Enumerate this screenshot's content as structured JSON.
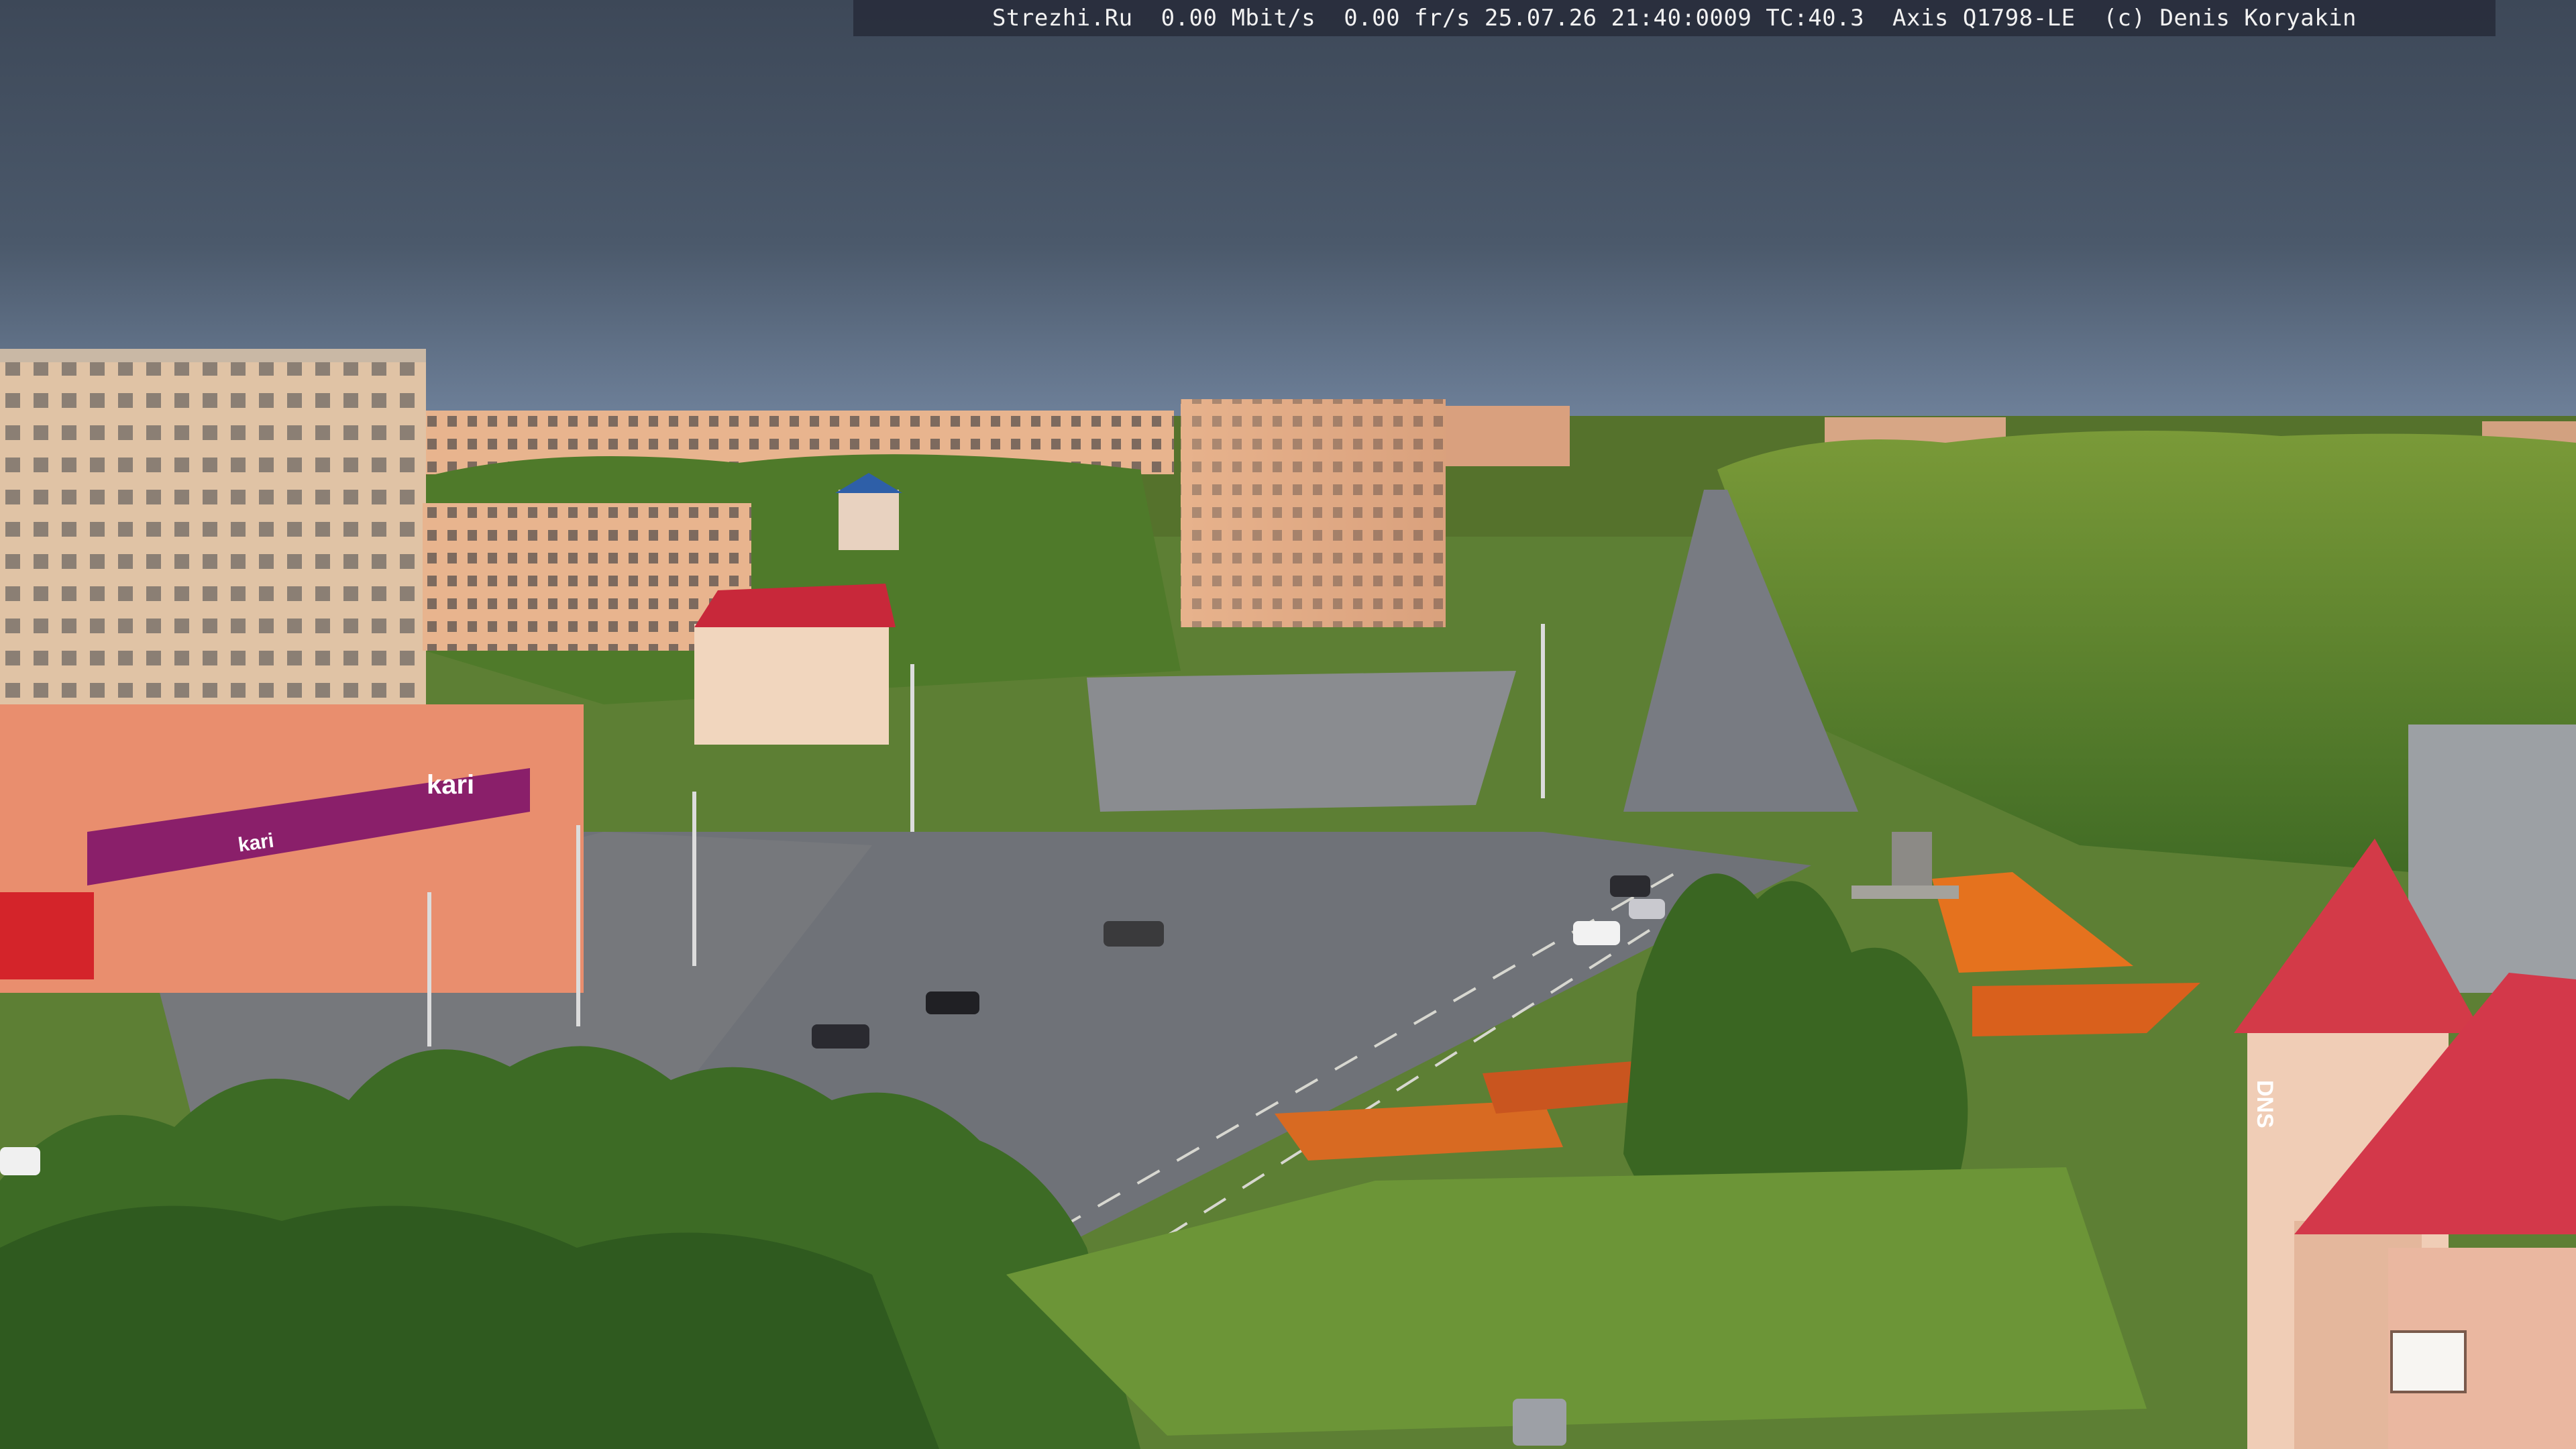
{
  "overlay": {
    "text": "Strezhi.Ru  0.00 Mbit/s  0.00 fr/s 25.07.26 21:40:0009 TC:40.3  Axis Q1798-LE  (c) Denis Koryakin"
  },
  "signs": {
    "kari_main": "kari",
    "kari_small": "kari",
    "tower_letters": "DNS"
  },
  "colors": {
    "sky_top": "#3e4a5c",
    "sky_horizon": "#6e7f93",
    "foliage": "#5f8a2e",
    "asphalt": "#6f7278",
    "roof_red": "#d8333f",
    "building_orange": "#e8a27a"
  }
}
